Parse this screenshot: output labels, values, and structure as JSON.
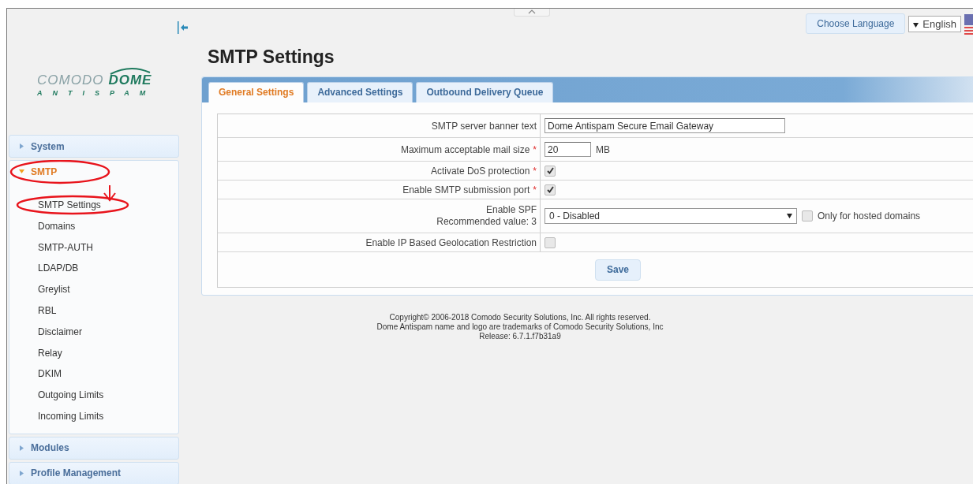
{
  "logo": {
    "name": "COMODO",
    "product": "DOME",
    "tagline": "ANTISPAM"
  },
  "header": {
    "language_button": "Choose Language",
    "language": "English"
  },
  "sidebar": {
    "sections": [
      {
        "label": "System",
        "expanded": false
      },
      {
        "label": "SMTP",
        "expanded": true,
        "children": [
          {
            "label": "SMTP Settings"
          },
          {
            "label": "Domains"
          },
          {
            "label": "SMTP-AUTH"
          },
          {
            "label": "LDAP/DB"
          },
          {
            "label": "Greylist"
          },
          {
            "label": "RBL"
          },
          {
            "label": "Disclaimer"
          },
          {
            "label": "Relay"
          },
          {
            "label": "DKIM"
          },
          {
            "label": "Outgoing Limits"
          },
          {
            "label": "Incoming Limits"
          }
        ]
      },
      {
        "label": "Modules",
        "expanded": false
      },
      {
        "label": "Profile Management",
        "expanded": false
      }
    ]
  },
  "page_title": "SMTP Settings",
  "tabs": [
    {
      "label": "General Settings",
      "selected": true
    },
    {
      "label": "Advanced Settings",
      "selected": false
    },
    {
      "label": "Outbound Delivery Queue",
      "selected": false
    }
  ],
  "fields": [
    {
      "kind": "text",
      "label": "SMTP server banner text",
      "value": "Dome Antispam Secure Email Gateway"
    },
    {
      "kind": "number",
      "label": "Maximum acceptable mail size",
      "required_mark": "*",
      "value": "20",
      "unit": "MB"
    },
    {
      "kind": "checkbox",
      "label": "Activate DoS protection",
      "required_mark": "*",
      "checked": true
    },
    {
      "kind": "checkbox",
      "label": "Enable SMTP submission port",
      "required_mark": "*",
      "checked": true
    },
    {
      "kind": "select",
      "label": "Enable SPF",
      "note": "Recommended value: 3",
      "value": "0 - Disabled",
      "option_label": "Only for hosted domains",
      "option_checked": false
    },
    {
      "kind": "checkbox",
      "label": "Enable IP Based Geolocation Restriction",
      "checked": false
    }
  ],
  "save_button": "Save",
  "footer": [
    "Copyright© 2006-2018 Comodo Security Solutions, Inc. All rights reserved.",
    "Dome Antispam name and logo are trademarks of Comodo Security Solutions, Inc",
    "Release: 6.7.1.f7b31a9"
  ]
}
